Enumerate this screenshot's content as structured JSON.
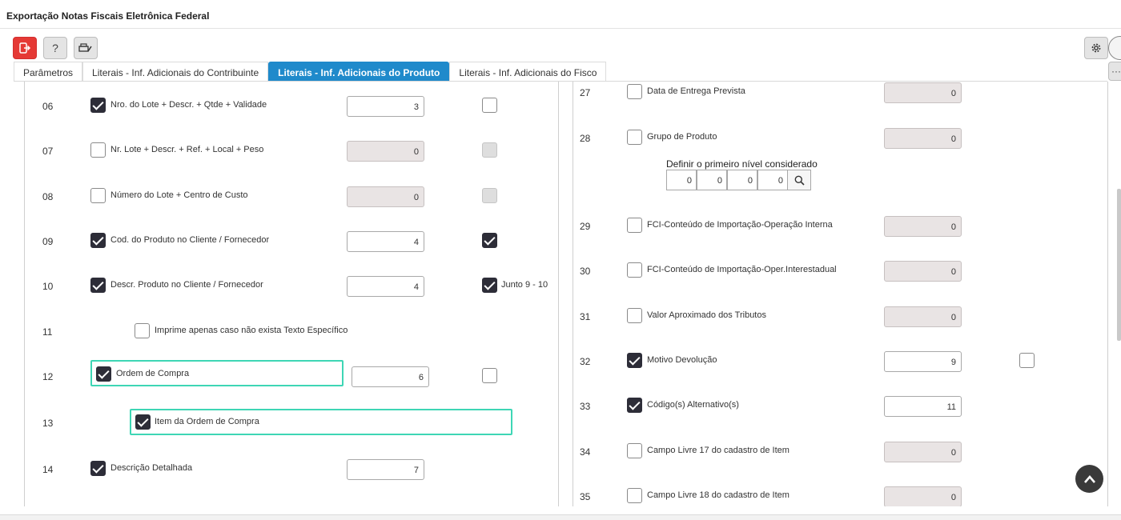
{
  "window": {
    "title": "Exportação Notas Fiscais Eletrônica Federal"
  },
  "toolbar": {
    "exit_icon": "exit-icon",
    "help_label": "?",
    "print_icon": "printer-edit-icon",
    "settings_icon": "gear-icon"
  },
  "tabs": [
    {
      "label": "Parâmetros",
      "active": false
    },
    {
      "label": "Literais - Inf. Adicionais do Contribuinte",
      "active": false
    },
    {
      "label": "Literais - Inf. Adicionais do Produto",
      "active": true
    },
    {
      "label": "Literais - Inf. Adicionais do Fisco",
      "active": false
    }
  ],
  "more_label": "···",
  "left_rows": [
    {
      "num": "06",
      "label": "Nro. do Lote + Descr. + Qtde + Validade",
      "checked": true,
      "value": "3",
      "value_disabled": false,
      "extra": "unchecked",
      "extra_label": ""
    },
    {
      "num": "07",
      "label": "Nr. Lote + Descr. + Ref. + Local + Peso",
      "checked": false,
      "value": "0",
      "value_disabled": true,
      "extra": "disabled",
      "extra_label": ""
    },
    {
      "num": "08",
      "label": "Número do Lote + Centro de Custo",
      "checked": false,
      "value": "0",
      "value_disabled": true,
      "extra": "disabled",
      "extra_label": ""
    },
    {
      "num": "09",
      "label": "Cod. do Produto no Cliente / Fornecedor",
      "checked": true,
      "value": "4",
      "value_disabled": false,
      "extra": "checked",
      "extra_label": ""
    },
    {
      "num": "10",
      "label": "Descr. Produto no Cliente / Fornecedor",
      "checked": true,
      "value": "4",
      "value_disabled": false,
      "extra": "checked",
      "extra_label": "Junto 9 - 10"
    },
    {
      "num": "11",
      "label": "Imprime apenas caso não exista Texto Específico",
      "checked": false
    },
    {
      "num": "12",
      "label": "Ordem de Compra",
      "checked": true,
      "value": "6",
      "value_disabled": false,
      "extra": "unchecked"
    },
    {
      "num": "13",
      "label": "Item da Ordem de Compra",
      "checked": true
    },
    {
      "num": "14",
      "label": "Descrição Detalhada",
      "checked": true,
      "value": "7",
      "value_disabled": false
    }
  ],
  "right_rows": [
    {
      "num": "27",
      "label": "Data de Entrega Prevista",
      "checked": false,
      "value": "0",
      "value_disabled": true
    },
    {
      "num": "28",
      "label": "Grupo de Produto",
      "checked": false,
      "value": "0",
      "value_disabled": true
    },
    {
      "num": "29",
      "label": "FCI-Conteúdo de Importação-Operação Interna",
      "checked": false,
      "value": "0",
      "value_disabled": true
    },
    {
      "num": "30",
      "label": "FCI-Conteúdo de Importação-Oper.Interestadual",
      "checked": false,
      "value": "0",
      "value_disabled": true
    },
    {
      "num": "31",
      "label": "Valor Aproximado dos Tributos",
      "checked": false,
      "value": "0",
      "value_disabled": true
    },
    {
      "num": "32",
      "label": "Motivo Devolução",
      "checked": true,
      "value": "9",
      "value_disabled": false,
      "extra": "unchecked"
    },
    {
      "num": "33",
      "label": "Código(s) Alternativo(s)",
      "checked": true,
      "value": "11",
      "value_disabled": false
    },
    {
      "num": "34",
      "label": "Campo Livre 17 do cadastro de Item",
      "checked": false,
      "value": "0",
      "value_disabled": true
    },
    {
      "num": "35",
      "label": "Campo Livre 18 do cadastro de Item",
      "checked": false,
      "value": "0",
      "value_disabled": true
    }
  ],
  "nivel": {
    "title": "Definir o primeiro nível considerado",
    "values": [
      "0",
      "0",
      "0",
      "0"
    ],
    "search_icon": "search-icon"
  },
  "scroll_top_icon": "chevron-up-icon"
}
